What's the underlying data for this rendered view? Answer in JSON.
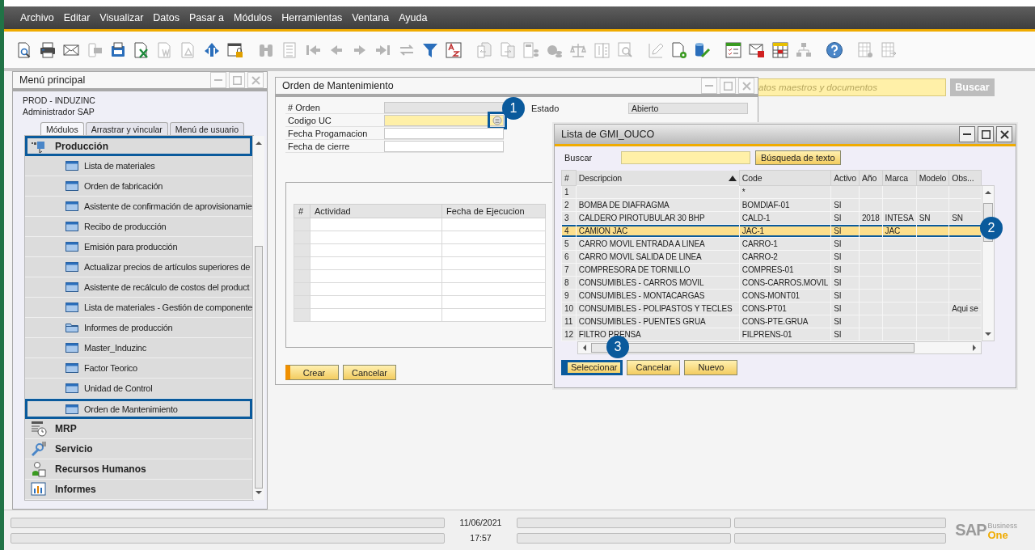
{
  "menu_bar": [
    "Archivo",
    "Editar",
    "Visualizar",
    "Datos",
    "Pasar a",
    "Módulos",
    "Herramientas",
    "Ventana",
    "Ayuda"
  ],
  "toolbar": [
    [
      {
        "kind": "preview",
        "disabled": false
      },
      {
        "kind": "print",
        "disabled": false
      },
      {
        "kind": "email",
        "disabled": false
      },
      {
        "kind": "sms",
        "disabled": true
      },
      {
        "kind": "fax",
        "disabled": false
      },
      {
        "kind": "excel",
        "disabled": false
      },
      {
        "kind": "word",
        "disabled": true
      },
      {
        "kind": "pdf",
        "disabled": true
      },
      {
        "kind": "navigate",
        "disabled": false
      },
      {
        "kind": "lock",
        "disabled": false
      }
    ],
    [
      {
        "kind": "find",
        "disabled": true
      },
      {
        "kind": "add",
        "disabled": true
      },
      {
        "kind": "first",
        "disabled": true
      },
      {
        "kind": "prev",
        "disabled": true
      },
      {
        "kind": "next",
        "disabled": true
      },
      {
        "kind": "last",
        "disabled": true
      },
      {
        "kind": "refresh",
        "disabled": true
      },
      {
        "kind": "filter",
        "disabled": false
      },
      {
        "kind": "sort",
        "disabled": false
      }
    ],
    [
      {
        "kind": "copy_from",
        "disabled": true
      },
      {
        "kind": "copy_to",
        "disabled": true
      },
      {
        "kind": "calc",
        "disabled": true
      },
      {
        "kind": "money",
        "disabled": true
      },
      {
        "kind": "scale",
        "disabled": true
      },
      {
        "kind": "dollar",
        "disabled": true
      },
      {
        "kind": "doc_search",
        "disabled": true
      }
    ],
    [
      {
        "kind": "edit",
        "disabled": true
      },
      {
        "kind": "doc_gear",
        "disabled": false
      },
      {
        "kind": "db_tool",
        "disabled": false
      }
    ],
    [
      {
        "kind": "checklist",
        "disabled": false
      },
      {
        "kind": "mail_alert",
        "disabled": false
      },
      {
        "kind": "calendar",
        "disabled": false
      },
      {
        "kind": "tree",
        "disabled": true
      }
    ],
    [
      {
        "kind": "help",
        "disabled": false
      }
    ],
    [
      {
        "kind": "table_gear",
        "disabled": true
      },
      {
        "kind": "table_export",
        "disabled": true
      }
    ]
  ],
  "global_search": {
    "placeholder": "atos maestros y documentos",
    "button": "Buscar"
  },
  "main_menu": {
    "title": "Menú principal",
    "active": false,
    "company": "PROD - INDUZINC",
    "user": "Administrador SAP",
    "tabs": [
      {
        "label": "Módulos",
        "selected": true
      },
      {
        "label": "Arrastrar y vincular",
        "selected": false
      },
      {
        "label": "Menú de usuario",
        "selected": false
      }
    ],
    "modules": [
      {
        "label": "Producción",
        "kind": "production",
        "highlighted": true,
        "children": [
          {
            "label": "Lista de materiales",
            "kind": "form",
            "highlighted": false
          },
          {
            "label": "Orden de fabricación",
            "kind": "form",
            "highlighted": false
          },
          {
            "label": "Asistente de confirmación de aprovisionamie",
            "kind": "form",
            "highlighted": false
          },
          {
            "label": "Recibo de producción",
            "kind": "form",
            "highlighted": false
          },
          {
            "label": "Emisión para producción",
            "kind": "form",
            "highlighted": false
          },
          {
            "label": "Actualizar precios de artículos superiores de",
            "kind": "form",
            "highlighted": false
          },
          {
            "label": "Asistente de recálculo de costos del product",
            "kind": "form",
            "highlighted": false
          },
          {
            "label": "Lista de materiales - Gestión de componente",
            "kind": "form",
            "highlighted": false
          },
          {
            "label": "Informes de producción",
            "kind": "folder",
            "highlighted": false
          },
          {
            "label": "Master_Induzinc",
            "kind": "form",
            "highlighted": false
          },
          {
            "label": "Factor Teorico",
            "kind": "form",
            "highlighted": false
          },
          {
            "label": "Unidad de Control",
            "kind": "form",
            "highlighted": false
          },
          {
            "label": "Orden de Mantenimiento",
            "kind": "form",
            "highlighted": true
          }
        ]
      },
      {
        "label": "MRP",
        "kind": "mrp",
        "highlighted": false
      },
      {
        "label": "Servicio",
        "kind": "service",
        "highlighted": false
      },
      {
        "label": "Recursos Humanos",
        "kind": "hr",
        "highlighted": false
      },
      {
        "label": "Informes",
        "kind": "reports",
        "highlighted": false
      }
    ]
  },
  "maintenance_order": {
    "title": "Orden de Mantenimiento",
    "active": false,
    "fields": [
      {
        "label": "# Orden",
        "disabled": true,
        "mandatory": false
      },
      {
        "label": "Codigo UC",
        "disabled": false,
        "mandatory": true,
        "choose_button": true,
        "highlighted": true,
        "callout": "1"
      },
      {
        "label": "Fecha Progamacion",
        "disabled": false,
        "mandatory": false
      },
      {
        "label": "Fecha de cierre",
        "disabled": false,
        "mandatory": false
      }
    ],
    "status": {
      "label": "Estado",
      "value": "Abierto"
    },
    "grid_columns": [
      "#",
      "Actividad",
      "Fecha de Ejecucion"
    ],
    "buttons": [
      {
        "label": "Crear",
        "primary": true
      },
      {
        "label": "Cancelar",
        "primary": false
      }
    ]
  },
  "choose_list": {
    "title": "Lista de GMI_OUCO",
    "active": true,
    "search_label": "Buscar",
    "search_button": "Búsqueda de texto",
    "columns": [
      {
        "label": "#",
        "sorted": false
      },
      {
        "label": "Descripcion",
        "sorted": true
      },
      {
        "label": "Code",
        "sorted": false
      },
      {
        "label": "Activo",
        "sorted": false
      },
      {
        "label": "Año",
        "sorted": false
      },
      {
        "label": "Marca",
        "sorted": false
      },
      {
        "label": "Modelo",
        "sorted": false
      },
      {
        "label": "Obs...",
        "sorted": false
      }
    ],
    "rows": [
      {
        "number": "1",
        "code": "*",
        "selected": false
      },
      {
        "number": "2",
        "description": "BOMBA DE DIAFRAGMA",
        "code": "BOMDIAF-01",
        "active": "SI",
        "selected": false
      },
      {
        "number": "3",
        "description": "CALDERO PIROTUBULAR 30 BHP",
        "code": "CALD-1",
        "active": "SI",
        "year": "2018",
        "brand": "INTESA",
        "model": "SN",
        "notes": "SN",
        "selected": false
      },
      {
        "number": "4",
        "description": "CAMION JAC",
        "code": "JAC-1",
        "active": "SI",
        "brand": "JAC",
        "selected": true,
        "callout": "2"
      },
      {
        "number": "5",
        "description": "CARRO MOVIL ENTRADA A LINEA",
        "code": "CARRO-1",
        "active": "SI",
        "selected": false
      },
      {
        "number": "6",
        "description": "CARRO MOVIL SALIDA DE LINEA",
        "code": "CARRO-2",
        "active": "SI",
        "selected": false
      },
      {
        "number": "7",
        "description": "COMPRESORA DE TORNILLO",
        "code": "COMPRES-01",
        "active": "SI",
        "selected": false
      },
      {
        "number": "8",
        "description": "CONSUMIBLES - CARROS MOVIL",
        "code": "CONS-CARROS.MOVIL",
        "active": "SI",
        "selected": false
      },
      {
        "number": "9",
        "description": "CONSUMIBLES - MONTACARGAS",
        "code": "CONS-MONT01",
        "active": "SI",
        "selected": false
      },
      {
        "number": "10",
        "description": "CONSUMIBLES - POLIPASTOS Y TECLES",
        "code": "CONS-PT01",
        "active": "SI",
        "notes": "Aqui se",
        "selected": false
      },
      {
        "number": "11",
        "description": "CONSUMIBLES - PUENTES GRUA",
        "code": "CONS-PTE.GRUA",
        "active": "SI",
        "selected": false
      },
      {
        "number": "12",
        "description": "FILTRO PRENSA",
        "code": "FILPRENS-01",
        "active": "SI",
        "selected": false
      }
    ],
    "buttons": [
      {
        "label": "Seleccionar",
        "primary": true,
        "highlighted": true,
        "callout": "3"
      },
      {
        "label": "Cancelar",
        "primary": false,
        "highlighted": false
      },
      {
        "label": "Nuevo",
        "primary": false,
        "highlighted": false
      }
    ]
  },
  "status_bar": {
    "date": "11/06/2021",
    "time": "17:57"
  },
  "logo": {
    "brand": "SAP",
    "line_1": "Business",
    "line_2": "One"
  }
}
